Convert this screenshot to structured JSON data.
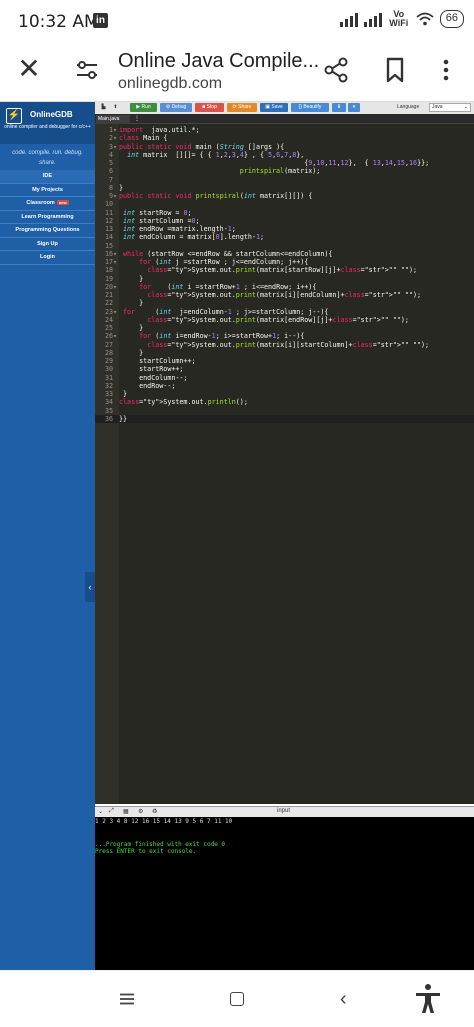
{
  "status_bar": {
    "time": "10:32 AM",
    "linkedin_badge": "in",
    "vowifi": "Vo WiFi",
    "battery": "66"
  },
  "browser": {
    "title": "Online Java Compile...",
    "url": "onlinegdb.com"
  },
  "sidebar": {
    "logo_name": "OnlineGDB",
    "logo_tagline": "online compiler and debugger for c/c++",
    "slogan": "code. compile. run. debug. share.",
    "items": [
      {
        "label": "IDE"
      },
      {
        "label": "My Projects"
      },
      {
        "label": "Classroom",
        "badge": "new"
      },
      {
        "label": "Learn Programming"
      },
      {
        "label": "Programming Questions"
      },
      {
        "label": "Sign Up"
      },
      {
        "label": "Login"
      }
    ]
  },
  "toolbar": {
    "run": "Run",
    "debug": "Debug",
    "stop": "Stop",
    "share": "Share",
    "save": "Save",
    "beautify": "{} Beautify",
    "language_label": "Language",
    "language_value": "Java"
  },
  "file_tab": "Main.java",
  "code_lines": [
    {
      "n": "1",
      "fold": "▾",
      "text": "import  java.util.*;"
    },
    {
      "n": "2",
      "fold": "▾",
      "text": "class Main {"
    },
    {
      "n": "3",
      "fold": "▾",
      "text": "public static void main (String []args ){"
    },
    {
      "n": "4",
      "fold": "",
      "text": "  int matrix  [][]= { { 1,2,3,4} , { 5,6,7,8},"
    },
    {
      "n": "5",
      "fold": "",
      "text": "                                              {9,10,11,12},  { 13,14,15,16}};"
    },
    {
      "n": "6",
      "fold": "",
      "text": "                              printspiral(matrix);"
    },
    {
      "n": "7",
      "fold": "",
      "text": ""
    },
    {
      "n": "8",
      "fold": "",
      "text": "}"
    },
    {
      "n": "9",
      "fold": "▾",
      "text": "public static void printspiral(int matrix[][]) {"
    },
    {
      "n": "10",
      "fold": "",
      "text": ""
    },
    {
      "n": "11",
      "fold": "",
      "text": " int startRow = 0;"
    },
    {
      "n": "12",
      "fold": "",
      "text": " int startColumn =0;"
    },
    {
      "n": "13",
      "fold": "",
      "text": " int endRow =matrix.length-1;"
    },
    {
      "n": "14",
      "fold": "",
      "text": " int endColumn = matrix[0].length-1;"
    },
    {
      "n": "15",
      "fold": "",
      "text": ""
    },
    {
      "n": "16",
      "fold": "▾",
      "text": " while (startRow <=endRow && startColumn<=endColumn){"
    },
    {
      "n": "17",
      "fold": "▾",
      "text": "     for (int j =startRow ; j<=endColumn; j++){"
    },
    {
      "n": "18",
      "fold": "",
      "text": "       System.out.print(matrix[startRow][j]+\" \");"
    },
    {
      "n": "19",
      "fold": "",
      "text": "     }"
    },
    {
      "n": "20",
      "fold": "▾",
      "text": "     for    (int i =startRow+1 ; i<=endRow; i++){"
    },
    {
      "n": "21",
      "fold": "",
      "text": "       System.out.print(matrix[i][endColumn]+\" \");"
    },
    {
      "n": "22",
      "fold": "",
      "text": "     }"
    },
    {
      "n": "23",
      "fold": "▾",
      "text": " for     (int  j=endColumn-1 ; j>=startColumn; j--){"
    },
    {
      "n": "24",
      "fold": "",
      "text": "       System.out.print(matrix[endRow][j]+\" \");"
    },
    {
      "n": "25",
      "fold": "",
      "text": "     }"
    },
    {
      "n": "26",
      "fold": "▾",
      "text": "     for (int i=endRow-1; i>=startRow+1; i--){"
    },
    {
      "n": "27",
      "fold": "",
      "text": "       System.out.print(matrix[i][startColumn]+\" \");"
    },
    {
      "n": "28",
      "fold": "",
      "text": "     }"
    },
    {
      "n": "29",
      "fold": "",
      "text": "     startColumn++;"
    },
    {
      "n": "30",
      "fold": "",
      "text": "     startRow++;"
    },
    {
      "n": "31",
      "fold": "",
      "text": "     endColumn--;"
    },
    {
      "n": "32",
      "fold": "",
      "text": "     endRow--;"
    },
    {
      "n": "33",
      "fold": "",
      "text": " }"
    },
    {
      "n": "34",
      "fold": "",
      "text": "System.out.println();"
    },
    {
      "n": "35",
      "fold": "",
      "text": ""
    },
    {
      "n": "36",
      "fold": "",
      "text": "}}"
    }
  ],
  "io": {
    "input_label": "input"
  },
  "console": {
    "output": "1 2 3 4 8 12 16 15 14 13 9 5 6 7 11 10",
    "finished": "...Program finished with exit code 0",
    "press_enter": "Press ENTER to exit console."
  },
  "colors": {
    "sidebar_bg": "#1e5fa8",
    "editor_bg": "#272822",
    "run_btn": "#3e8e41",
    "debug_btn": "#5a8ed0",
    "stop_btn": "#d9534f",
    "share_btn": "#e08a2b",
    "save_btn": "#2f6fb8",
    "beautify_btn": "#4a89d4",
    "console_green": "#3fe03f"
  }
}
